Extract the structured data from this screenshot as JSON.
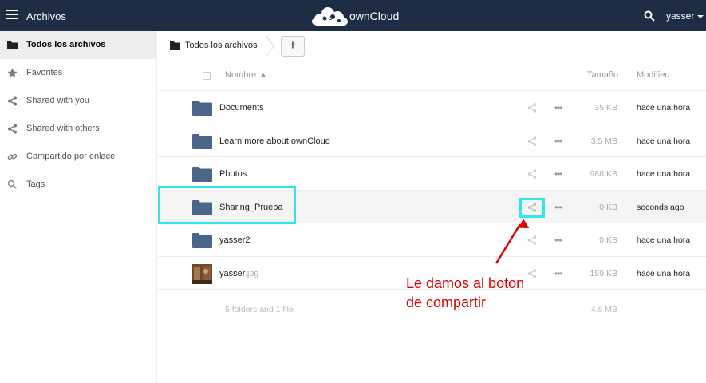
{
  "header": {
    "app_title": "Archivos",
    "logo_text": "ownCloud",
    "username": "yasser",
    "bg_color": "#1d2d44"
  },
  "sidebar": {
    "items": [
      {
        "label": "Todos los archivos",
        "icon": "folder-icon",
        "active": true
      },
      {
        "label": "Favorites",
        "icon": "star-icon"
      },
      {
        "label": "Shared with you",
        "icon": "share-icon"
      },
      {
        "label": "Shared with others",
        "icon": "share-icon"
      },
      {
        "label": "Compartido por enlace",
        "icon": "link-icon"
      },
      {
        "label": "Tags",
        "icon": "search-icon"
      }
    ]
  },
  "breadcrumb": {
    "label": "Todos los archivos",
    "new_button": "+"
  },
  "table": {
    "headers": {
      "name": "Nombre",
      "size": "Tamaño",
      "modified": "Modified"
    },
    "rows": [
      {
        "name": "Documents",
        "ext": "",
        "type": "folder",
        "size": "35 KB",
        "modified": "hace una hora"
      },
      {
        "name": "Learn more about ownCloud",
        "ext": "",
        "type": "folder",
        "size": "3.5 MB",
        "modified": "hace una hora"
      },
      {
        "name": "Photos",
        "ext": "",
        "type": "folder",
        "size": "988 KB",
        "modified": "hace una hora"
      },
      {
        "name": "Sharing_Prueba",
        "ext": "",
        "type": "folder",
        "size": "0 KB",
        "modified": "seconds ago"
      },
      {
        "name": "yasser2",
        "ext": "",
        "type": "folder",
        "size": "0 KB",
        "modified": "hace una hora"
      },
      {
        "name": "yasser",
        "ext": ".jpg",
        "type": "image",
        "size": "159 KB",
        "modified": "hace una hora"
      }
    ],
    "summary": {
      "count": "5 folders and 1 file",
      "total": "4.6 MB"
    }
  },
  "annotation": {
    "line1": "Le damos al boton",
    "line2": "de compartir",
    "box_color": "#2ee6f0",
    "text_color": "#e00000"
  }
}
